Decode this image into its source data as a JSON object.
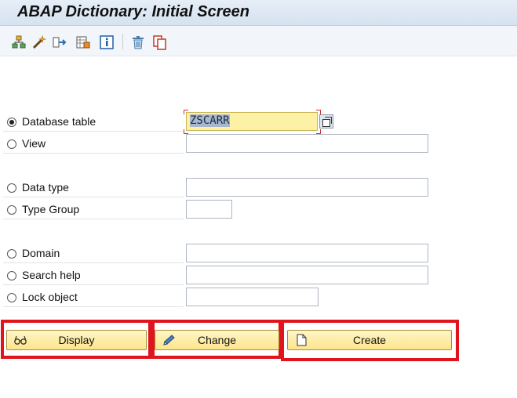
{
  "window": {
    "title": "ABAP Dictionary: Initial Screen"
  },
  "toolbar": {
    "icons": [
      "hierarchy-icon",
      "wand-icon",
      "transfer-icon",
      "grid-icon",
      "info-icon",
      "delete-icon",
      "copy-icon"
    ]
  },
  "object_types": [
    {
      "label": "Database table",
      "selected": true,
      "value": "ZSCARR"
    },
    {
      "label": "View",
      "selected": false,
      "value": ""
    },
    {
      "label": "Data type",
      "selected": false,
      "value": ""
    },
    {
      "label": "Type Group",
      "selected": false,
      "value": ""
    },
    {
      "label": "Domain",
      "selected": false,
      "value": ""
    },
    {
      "label": "Search help",
      "selected": false,
      "value": ""
    },
    {
      "label": "Lock object",
      "selected": false,
      "value": ""
    }
  ],
  "actions": {
    "display_label": "Display",
    "change_label": "Change",
    "create_label": "Create"
  },
  "colors": {
    "highlight": "#e0141c",
    "button_fill": "#fde58a",
    "active_field": "#fdf1a6"
  }
}
